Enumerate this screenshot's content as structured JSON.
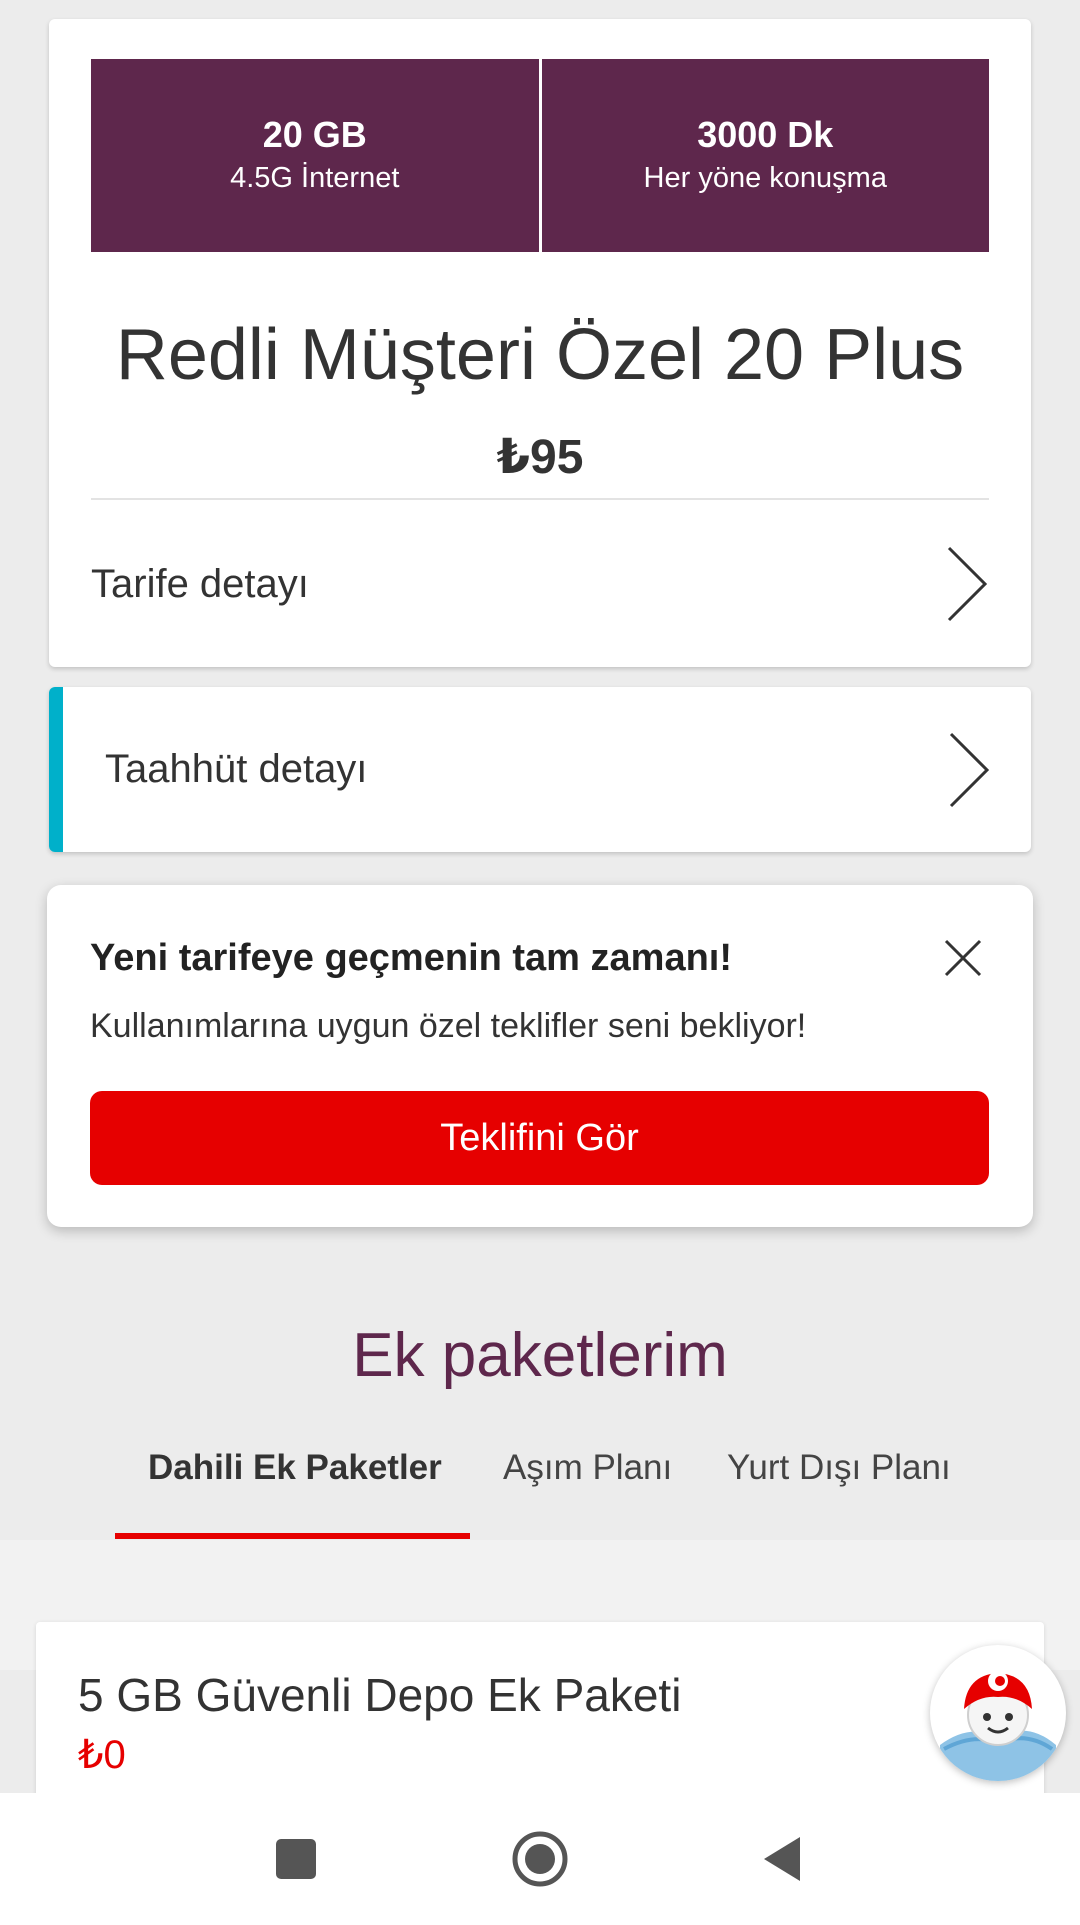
{
  "plan": {
    "allowances": [
      {
        "amount": "20 GB",
        "desc": "4.5G İnternet"
      },
      {
        "amount": "3000 Dk",
        "desc": "Her yöne konuşma"
      }
    ],
    "name": "Redli Müşteri Özel 20 Plus",
    "price": "₺95",
    "tariff_detail_label": "Tarife detayı"
  },
  "commitment": {
    "label": "Taahhüt detayı"
  },
  "offer": {
    "title": "Yeni tarifeye geçmenin tam zamanı!",
    "subtitle": "Kullanımlarına uygun özel teklifler seni bekliyor!",
    "button_label": "Teklifini Gör"
  },
  "addons": {
    "title": "Ek paketlerim",
    "tabs": [
      {
        "label": "Dahili Ek Paketler",
        "active": true
      },
      {
        "label": "Aşım Planı",
        "active": false
      },
      {
        "label": "Yurt Dışı Planı",
        "active": false
      }
    ],
    "packages": [
      {
        "name": "5 GB Güvenli Depo Ek Paketi",
        "price": "₺0"
      }
    ]
  },
  "colors": {
    "brand_purple": "#5e274c",
    "brand_red": "#e60000",
    "accent_cyan": "#00b0ca"
  },
  "icons": [
    "chevron-right-icon",
    "close-icon",
    "chatbot-avatar-icon",
    "recents-icon",
    "home-icon",
    "back-icon"
  ]
}
